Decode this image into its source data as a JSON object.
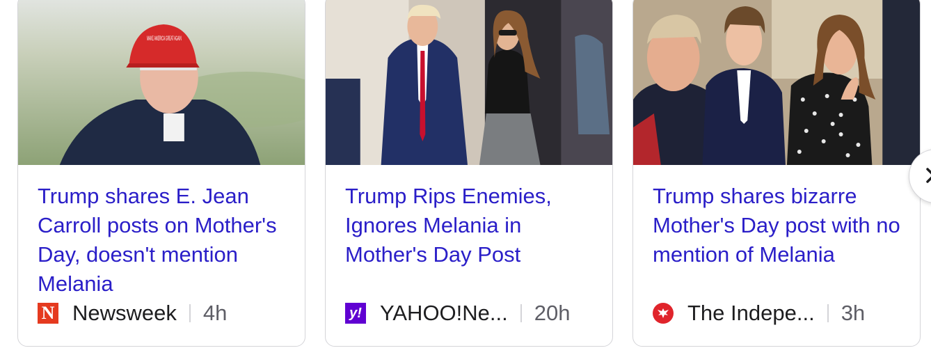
{
  "cards": [
    {
      "headline": "Trump shares E. Jean Carroll posts on Mother's Day, doesn't mention Melania",
      "source": "Newsweek",
      "source_logo": "N",
      "time": "4h",
      "image": "trump-golf-red-cap-photo",
      "hat_text": "MAKE AMERICA GREAT AGAIN"
    },
    {
      "headline": "Trump Rips Enemies, Ignores Melania in Mother's Day Post",
      "source": "YAHOO!Ne...",
      "source_logo": "y!",
      "time": "20h",
      "image": "trump-melania-walking-photo"
    },
    {
      "headline": "Trump shares bizarre Mother's Day post with no mention of Melania",
      "source": "The Indepe...",
      "source_logo": "eagle",
      "time": "3h",
      "image": "trump-barron-melania-photo"
    }
  ],
  "colors": {
    "headline": "#2a1ec8",
    "newsweek": "#e53a1f",
    "yahoo": "#6001d2",
    "independent": "#e0242b"
  },
  "nav": {
    "next_icon": "chevron-right-icon"
  }
}
